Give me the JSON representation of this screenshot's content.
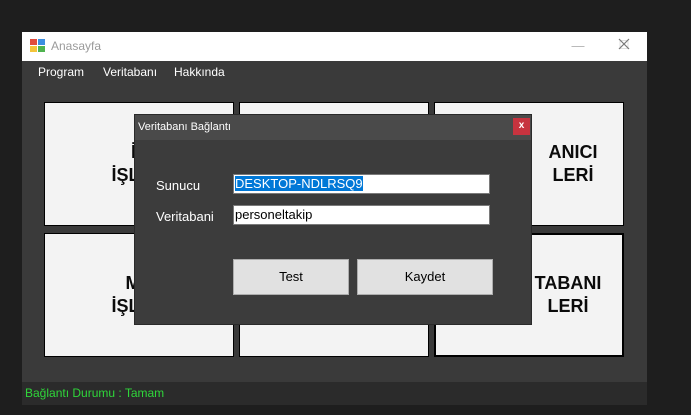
{
  "window": {
    "title": "Anasayfa",
    "controls": {
      "minimize": "—",
      "maximize": "☐",
      "close": "✕"
    }
  },
  "menu": [
    {
      "label": "Program"
    },
    {
      "label": "Veritabanı"
    },
    {
      "label": "Hakkında"
    }
  ],
  "tiles": [
    {
      "line1": "İZ",
      "line2": "İŞLEM"
    },
    {
      "line1": "",
      "line2": ""
    },
    {
      "line1": "ANICI",
      "line2": "LERİ"
    },
    {
      "line1": "ME",
      "line2": "İŞLEM"
    },
    {
      "line1": "",
      "line2": ""
    },
    {
      "line1": "TABANI",
      "line2": "LERİ"
    }
  ],
  "status": {
    "text": "Bağlantı Durumu : Tamam"
  },
  "dialog": {
    "title": "Veritabanı Bağlantı",
    "close_label": "x",
    "server_label": "Sunucu",
    "server_value": "DESKTOP-NDLRSQ9",
    "database_label": "Veritabani",
    "database_value": "personeltakip",
    "test_button": "Test",
    "save_button": "Kaydet"
  },
  "colors": {
    "status_green": "#2fd63a",
    "close_red": "#c7333f",
    "selection_blue": "#0078d7"
  }
}
